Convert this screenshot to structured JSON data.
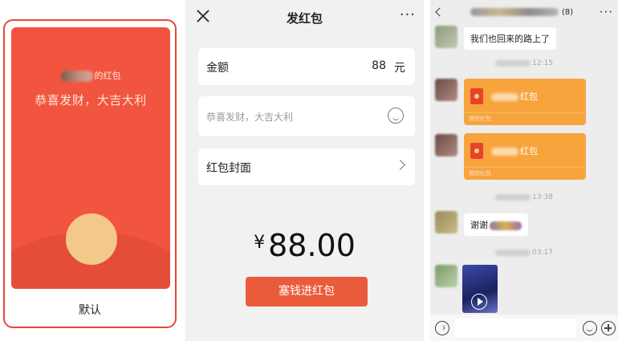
{
  "cover_preview": {
    "sender_suffix": "的红包",
    "greeting": "恭喜发财，大吉大利",
    "default_label": "默认"
  },
  "send_form": {
    "title": "发红包",
    "more": "···",
    "amount_label": "金额",
    "amount_value": "88",
    "amount_unit": "元",
    "greeting_placeholder": "恭喜发财，大吉大利",
    "cover_label": "红包封面",
    "currency_symbol": "¥",
    "total_amount": "88.00",
    "send_button": "塞钱进红包"
  },
  "chat": {
    "member_count": "(8)",
    "more": "···",
    "messages": {
      "m1_text": "我们也回来的路上了",
      "t1": "12:15",
      "rp1_suffix": "红包",
      "rp1_footer": "微信红包",
      "rp2_suffix": "红包",
      "rp2_footer": "微信红包",
      "t2": "13:38",
      "m2_text": "谢谢",
      "t3": "03:17"
    }
  },
  "colors": {
    "packet_red": "#f2553f",
    "send_button": "#ea5b3c",
    "chat_red_packet": "#f8a43d",
    "coin": "#f3c98a"
  }
}
